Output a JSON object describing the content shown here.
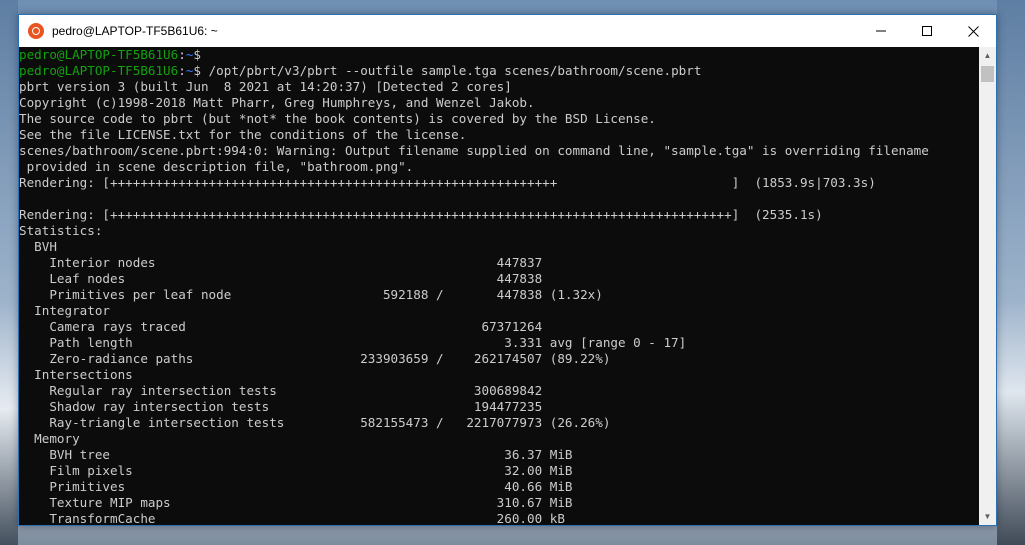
{
  "window": {
    "title": "pedro@LAPTOP-TF5B61U6: ~",
    "controls": {
      "minimize": "—",
      "maximize": "☐",
      "close": "✕"
    }
  },
  "terminal": {
    "lines": [
      {
        "user": "pedro@LAPTOP-TF5B61U6",
        "sep": ":",
        "path": "~",
        "text": "$"
      },
      {
        "user": "pedro@LAPTOP-TF5B61U6",
        "sep": ":",
        "path": "~",
        "text": "$ /opt/pbrt/v3/pbrt --outfile sample.tga scenes/bathroom/scene.pbrt"
      },
      {
        "text": "pbrt version 3 (built Jun  8 2021 at 14:20:37) [Detected 2 cores]"
      },
      {
        "text": "Copyright (c)1998-2018 Matt Pharr, Greg Humphreys, and Wenzel Jakob."
      },
      {
        "text": "The source code to pbrt (but *not* the book contents) is covered by the BSD License."
      },
      {
        "text": "See the file LICENSE.txt for the conditions of the license."
      },
      {
        "text": "scenes/bathroom/scene.pbrt:994:0: Warning: Output filename supplied on command line, \"sample.tga\" is overriding filename"
      },
      {
        "text": " provided in scene description file, \"bathroom.png\"."
      },
      {
        "text": "Rendering: [+++++++++++++++++++++++++++++++++++++++++++++++++++++++++++                       ]  (1853.9s|703.3s)"
      },
      {
        "text": ""
      },
      {
        "text": "Rendering: [++++++++++++++++++++++++++++++++++++++++++++++++++++++++++++++++++++++++++++++++++]  (2535.1s)"
      },
      {
        "text": "Statistics:"
      },
      {
        "text": "  BVH"
      },
      {
        "text": "    Interior nodes                                             447837"
      },
      {
        "text": "    Leaf nodes                                                 447838"
      },
      {
        "text": "    Primitives per leaf node                    592188 /       447838 (1.32x)"
      },
      {
        "text": "  Integrator"
      },
      {
        "text": "    Camera rays traced                                       67371264"
      },
      {
        "text": "    Path length                                                 3.331 avg [range 0 - 17]"
      },
      {
        "text": "    Zero-radiance paths                      233903659 /    262174507 (89.22%)"
      },
      {
        "text": "  Intersections"
      },
      {
        "text": "    Regular ray intersection tests                          300689842"
      },
      {
        "text": "    Shadow ray intersection tests                           194477235"
      },
      {
        "text": "    Ray-triangle intersection tests          582155473 /   2217077973 (26.26%)"
      },
      {
        "text": "  Memory"
      },
      {
        "text": "    BVH tree                                                    36.37 MiB"
      },
      {
        "text": "    Film pixels                                                 32.00 MiB"
      },
      {
        "text": "    Primitives                                                  40.66 MiB"
      },
      {
        "text": "    Texture MIP maps                                           310.67 MiB"
      },
      {
        "text": "    TransformCache                                             260.00 kB"
      }
    ]
  },
  "scrollbar": {
    "up_glyph": "▲",
    "down_glyph": "▼"
  },
  "colors": {
    "prompt_user": "#13a10e",
    "prompt_path": "#3b78ff",
    "terminal_bg": "#0c0c0c",
    "terminal_text": "#cccccc",
    "ubuntu_orange": "#e95420"
  },
  "icons": {
    "app": "ubuntu-icon",
    "minimize": "minimize-icon",
    "maximize": "maximize-icon",
    "close": "close-icon"
  }
}
